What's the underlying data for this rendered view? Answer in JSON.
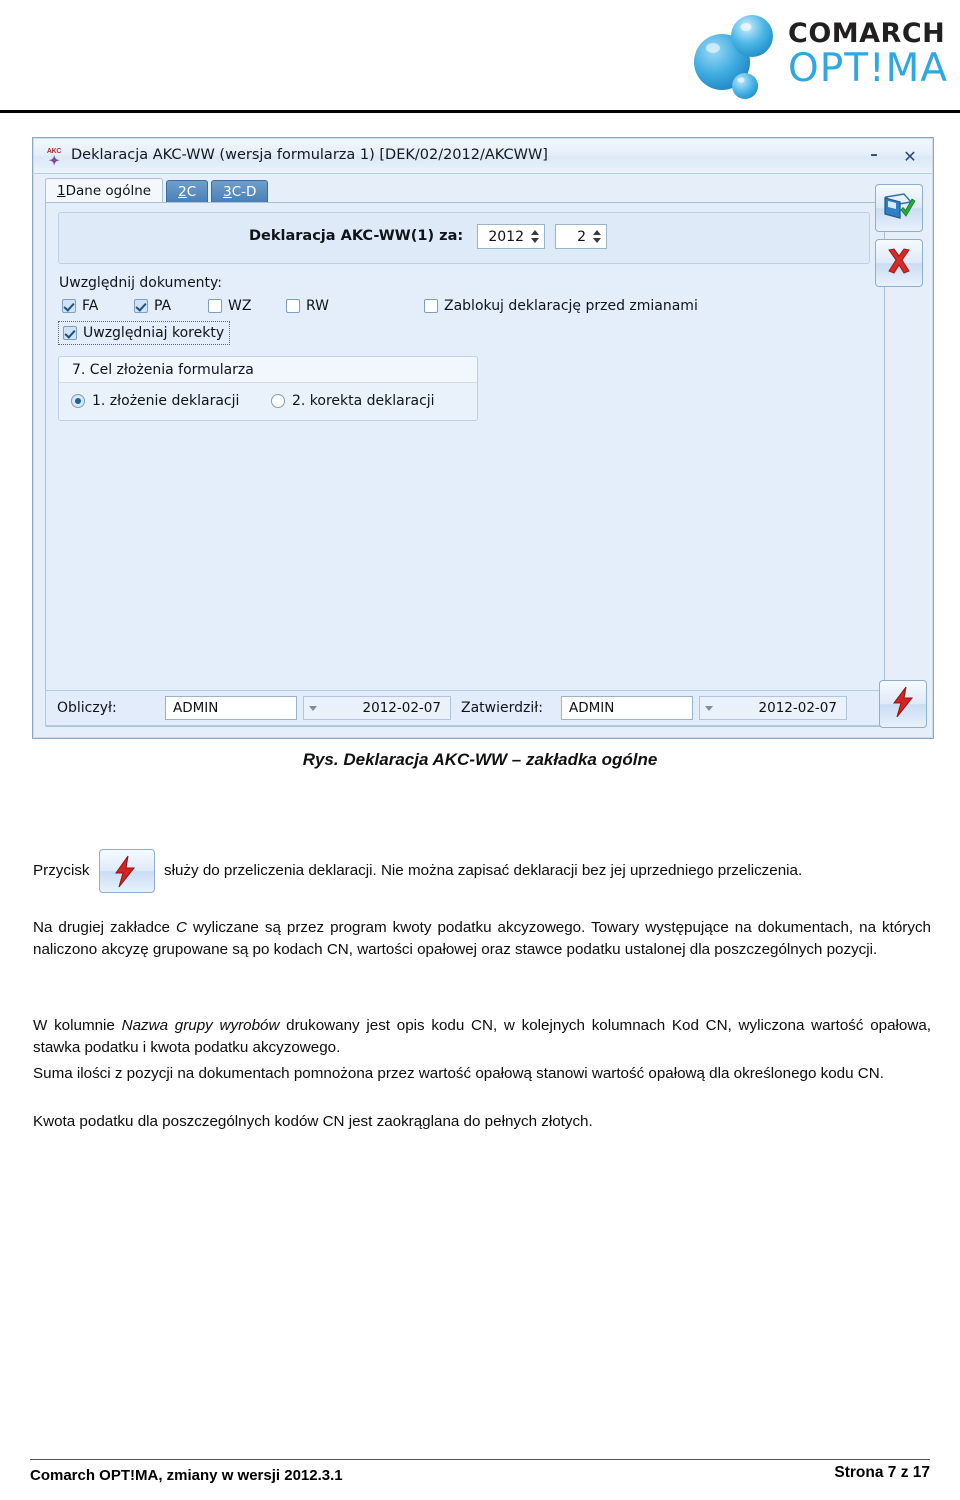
{
  "header": {
    "logo_primary": "COMARCH",
    "logo_secondary": "OPT!MA",
    "logo_mark_icon": "comarch-molecule-logo"
  },
  "dialog": {
    "title": "Deklaracja AKC-WW (wersja formularza 1) [DEK/02/2012/AKCWW]",
    "app_icon": "akc-document-icon",
    "window_buttons": {
      "minimize": "–",
      "close": "✕"
    },
    "tabs": [
      {
        "num": "1",
        "label": " Dane ogólne",
        "active": true
      },
      {
        "num": "2",
        "label": " C",
        "active": false
      },
      {
        "num": "3",
        "label": " C-D",
        "active": false
      }
    ],
    "period": {
      "label": "Deklaracja AKC-WW(1) za:",
      "year": "2012",
      "month": "2"
    },
    "include_documents": {
      "label": "Uwzględnij dokumenty:",
      "checkboxes": [
        {
          "label": "FA",
          "checked": true
        },
        {
          "label": "PA",
          "checked": true
        },
        {
          "label": "WZ",
          "checked": false
        },
        {
          "label": "RW",
          "checked": false
        }
      ],
      "lock": {
        "label": "Zablokuj deklarację przed zmianami",
        "checked": false
      },
      "corrections": {
        "label": "Uwzględniaj korekty",
        "checked": true
      }
    },
    "purpose": {
      "header": "7. Cel złożenia formularza",
      "options": [
        {
          "label": "1. złożenie deklaracji",
          "selected": true
        },
        {
          "label": "2. korekta deklaracji",
          "selected": false
        }
      ]
    },
    "footer_bar": {
      "calculated_by_label": "Obliczył:",
      "calculated_by_value": "ADMIN",
      "calculated_date": "2012-02-07",
      "approved_by_label": "Zatwierdził:",
      "approved_by_value": "ADMIN",
      "approved_date": "2012-02-07"
    },
    "side_buttons": [
      {
        "name": "save-button",
        "icon": "floppy-disk-check-icon"
      },
      {
        "name": "cancel-button",
        "icon": "red-x-icon"
      },
      {
        "name": "recalculate-button",
        "icon": "red-lightning-icon"
      }
    ]
  },
  "figure_caption": "Rys. Deklaracja AKC-WW – zakładka ogólne",
  "body": {
    "button_paragraph_prefix": "Przycisk",
    "button_paragraph_suffix": "służy do przeliczenia deklaracji. Nie można zapisać deklaracji bez jej uprzedniego przeliczenia.",
    "p1_a": "Na drugiej zakładce ",
    "p1_italic": "C",
    "p1_b": " wyliczane są przez program kwoty podatku akcyzowego. Towary występujące na dokumentach, na których naliczono akcyzę grupowane są po kodach CN, wartości opałowej oraz stawce podatku ustalonej dla poszczególnych pozycji.",
    "p2_a": "W kolumnie ",
    "p2_italic": "Nazwa grupy wyrobów",
    "p2_b": " drukowany jest opis kodu CN, w kolejnych kolumnach Kod CN, wyliczona wartość opałowa, stawka podatku i kwota podatku akcyzowego.",
    "p3": "Suma ilości z pozycji na dokumentach pomnożona przez wartość opałową stanowi wartość opałową dla określonego kodu CN.",
    "p4": "Kwota podatku dla poszczególnych kodów CN jest zaokrąglana do pełnych złotych."
  },
  "page_footer": {
    "left": "Comarch OPT!MA, zmiany w wersji 2012.3.1",
    "right": "Strona 7 z 17"
  }
}
